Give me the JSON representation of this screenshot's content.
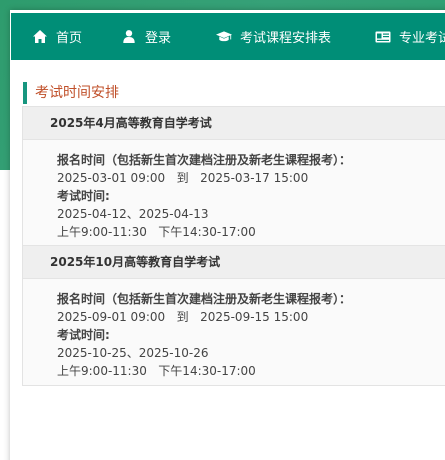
{
  "colors": {
    "nav_bg": "#008e77",
    "bg_green": "#2e9c6d",
    "section_accent": "#17967f",
    "section_title": "#c0502a"
  },
  "nav": {
    "items": [
      {
        "label": "首页",
        "icon": "home-icon"
      },
      {
        "label": "登录",
        "icon": "user-icon"
      },
      {
        "label": "考试课程安排表",
        "icon": "graduation-cap-icon"
      },
      {
        "label": "专业考试",
        "icon": "id-card-icon"
      }
    ]
  },
  "section": {
    "title": "考试时间安排"
  },
  "exams": [
    {
      "title": "2025年4月高等教育自学考试",
      "registration_label": "报名时间（包括新生首次建档注册及新老生课程报考）：",
      "registration_start": "2025-03-01 09:00",
      "registration_to": "到",
      "registration_end": "2025-03-17 15:00",
      "exam_label": "考试时间:",
      "exam_dates": "2025-04-12、2025-04-13",
      "exam_sessions": "上午9:00-11:30   下午14:30-17:00"
    },
    {
      "title": "2025年10月高等教育自学考试",
      "registration_label": "报名时间（包括新生首次建档注册及新老生课程报考）：",
      "registration_start": "2025-09-01 09:00",
      "registration_to": "到",
      "registration_end": "2025-09-15 15:00",
      "exam_label": "考试时间:",
      "exam_dates": "2025-10-25、2025-10-26",
      "exam_sessions": "上午9:00-11:30   下午14:30-17:00"
    }
  ]
}
